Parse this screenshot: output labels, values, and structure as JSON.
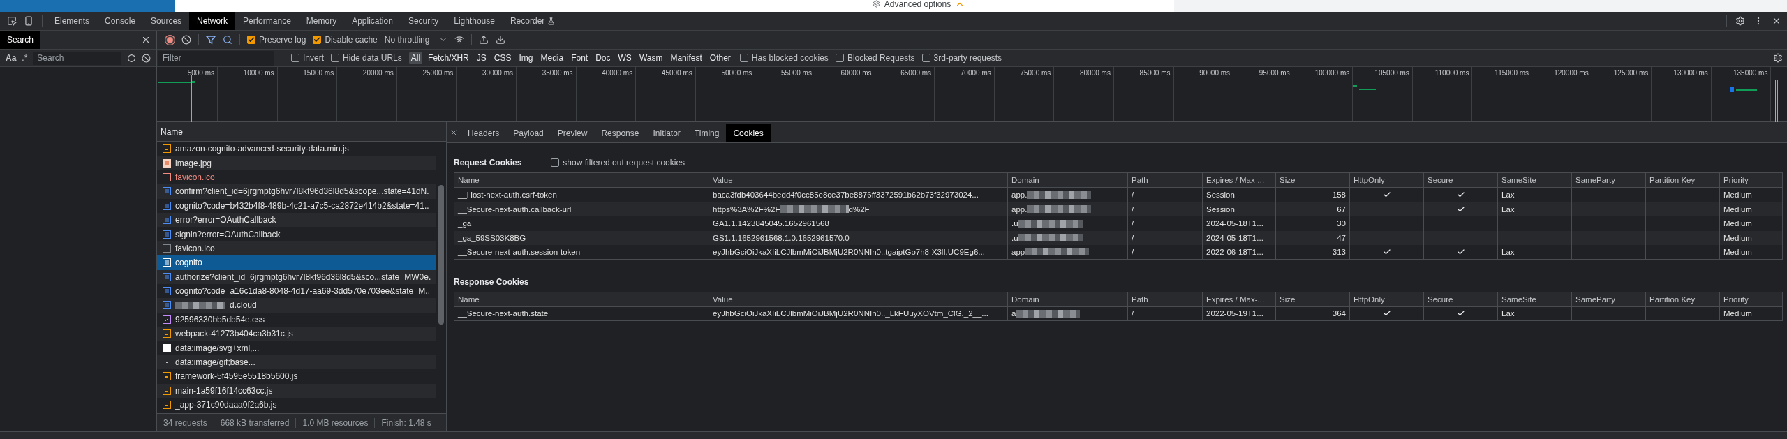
{
  "page_strip": {
    "text": "Advanced options"
  },
  "devtools_tabs": [
    {
      "label": "Elements",
      "selected": false
    },
    {
      "label": "Console",
      "selected": false
    },
    {
      "label": "Sources",
      "selected": false
    },
    {
      "label": "Network",
      "selected": true
    },
    {
      "label": "Performance",
      "selected": false
    },
    {
      "label": "Memory",
      "selected": false
    },
    {
      "label": "Application",
      "selected": false
    },
    {
      "label": "Security",
      "selected": false
    },
    {
      "label": "Lighthouse",
      "selected": false
    },
    {
      "label": "Recorder",
      "selected": false,
      "kind": "experimental"
    }
  ],
  "search_panel": {
    "tab": "Search",
    "case_toggle": "Aa",
    "regex_toggle": ".*",
    "placeholder": "Search"
  },
  "toolbar": {
    "checkboxes": [
      {
        "label": "Preserve log",
        "checked": true
      },
      {
        "label": "Disable cache",
        "checked": true
      }
    ],
    "throttling": "No throttling"
  },
  "filter": {
    "placeholder": "Filter",
    "checkboxes_left": [
      {
        "label": "Invert",
        "checked": false
      },
      {
        "label": "Hide data URLs",
        "checked": false
      }
    ],
    "types": [
      {
        "label": "All",
        "selected": true
      },
      {
        "label": "Fetch/XHR",
        "selected": false
      },
      {
        "label": "JS",
        "selected": false
      },
      {
        "label": "CSS",
        "selected": false
      },
      {
        "label": "Img",
        "selected": false
      },
      {
        "label": "Media",
        "selected": false
      },
      {
        "label": "Font",
        "selected": false
      },
      {
        "label": "Doc",
        "selected": false
      },
      {
        "label": "WS",
        "selected": false
      },
      {
        "label": "Wasm",
        "selected": false
      },
      {
        "label": "Manifest",
        "selected": false
      },
      {
        "label": "Other",
        "selected": false
      }
    ],
    "checkboxes_right": [
      {
        "label": "Has blocked cookies",
        "checked": false
      },
      {
        "label": "Blocked Requests",
        "checked": false
      },
      {
        "label": "3rd-party requests",
        "checked": false
      }
    ]
  },
  "timeline": {
    "ticks": [
      "5000 ms",
      "10000 ms",
      "15000 ms",
      "20000 ms",
      "25000 ms",
      "30000 ms",
      "35000 ms",
      "40000 ms",
      "45000 ms",
      "50000 ms",
      "55000 ms",
      "60000 ms",
      "65000 ms",
      "70000 ms",
      "75000 ms",
      "80000 ms",
      "85000 ms",
      "90000 ms",
      "95000 ms",
      "100000 ms",
      "105000 ms",
      "110000 ms",
      "115000 ms",
      "120000 ms",
      "125000 ms",
      "130000 ms",
      "135000 ms"
    ]
  },
  "requests": {
    "header": "Name",
    "rows": [
      {
        "name": "amazon-cognito-advanced-security-data.min.js",
        "kind": "script",
        "selected": false
      },
      {
        "name": "image.jpg",
        "kind": "image",
        "selected": false
      },
      {
        "name": "favicon.ico",
        "kind": "failed",
        "selected": false
      },
      {
        "name": "confirm?client_id=6jrgmptg6hvr7l8kf96d36l8d5&scope...state=41dN.",
        "kind": "document",
        "selected": false
      },
      {
        "name": "cognito?code=b432b4f8-489b-4c21-a7c5-ca2872e414b2&state=41..",
        "kind": "document",
        "selected": false
      },
      {
        "name": "error?error=OAuthCallback",
        "kind": "document",
        "selected": false
      },
      {
        "name": "signin?error=OAuthCallback",
        "kind": "document",
        "selected": false
      },
      {
        "name": "favicon.ico",
        "kind": "other",
        "selected": false
      },
      {
        "name": "cognito",
        "kind": "document",
        "selected": true
      },
      {
        "name": "authorize?client_id=6jrgmptg6hvr7l8kf96d36l8d5&sco...state=MW0e.",
        "kind": "document",
        "selected": false
      },
      {
        "name": "cognito?code=a16c1da8-8048-4d17-aa69-3dd570e703ee&state=M..",
        "kind": "document",
        "selected": false
      },
      {
        "name": "d.cloud",
        "kind": "document",
        "selected": false,
        "redacted_prefix": true
      },
      {
        "name": "92596330bb5db54e.css",
        "kind": "stylesheet",
        "selected": false
      },
      {
        "name": "webpack-41273b404ca3b31c.js",
        "kind": "script",
        "selected": false
      },
      {
        "name": "data:image/svg+xml,...",
        "kind": "svg",
        "selected": false
      },
      {
        "name": "data:image/gif;base...",
        "kind": "gif",
        "selected": false
      },
      {
        "name": "framework-5f4595e5518b5600.js",
        "kind": "script",
        "selected": false
      },
      {
        "name": "main-1a59f16f14cc63cc.js",
        "kind": "script",
        "selected": false
      },
      {
        "name": "_app-371c90daaa0f2a6b.js",
        "kind": "script",
        "selected": false
      }
    ],
    "status": [
      "34 requests",
      "668 kB transferred",
      "1.0 MB resources",
      "Finish: 1.48 s"
    ]
  },
  "details": {
    "tabs": [
      {
        "label": "Headers",
        "selected": false
      },
      {
        "label": "Payload",
        "selected": false
      },
      {
        "label": "Preview",
        "selected": false
      },
      {
        "label": "Response",
        "selected": false
      },
      {
        "label": "Initiator",
        "selected": false
      },
      {
        "label": "Timing",
        "selected": false
      },
      {
        "label": "Cookies",
        "selected": true
      }
    ],
    "request_cookies": {
      "title": "Request Cookies",
      "filter_toggle": {
        "label": "show filtered out request cookies",
        "checked": false
      },
      "columns": [
        "Name",
        "Value",
        "Domain",
        "Path",
        "Expires / Max-...",
        "Size",
        "HttpOnly",
        "Secure",
        "SameSite",
        "SameParty",
        "Partition Key",
        "Priority"
      ],
      "rows": [
        {
          "name": "__Host-next-auth.csrf-token",
          "value": [
            "baca3fdb403644bedd4f0cc85e8ce37be8876ff3372591b62b73f32973024..."
          ],
          "domain": "app.",
          "domain_redacted": true,
          "path": "/",
          "expires": "Session",
          "size": "158",
          "http_only": true,
          "secure": true,
          "same_site": "Lax",
          "priority": "Medium"
        },
        {
          "name": "__Secure-next-auth.callback-url",
          "value": [
            "https%3A%2F%2F",
            "d%2F"
          ],
          "domain": "app.",
          "domain_redacted": true,
          "path": "/",
          "expires": "Session",
          "size": "67",
          "http_only": false,
          "secure": true,
          "same_site": "Lax",
          "priority": "Medium"
        },
        {
          "name": "_ga",
          "value": [
            "GA1.1.1423845045.1652961568"
          ],
          "domain": ".u",
          "domain_redacted": true,
          "path": "/",
          "expires": "2024-05-18T1...",
          "size": "30",
          "http_only": false,
          "secure": false,
          "priority": "Medium"
        },
        {
          "name": "_ga_59SS03K8BG",
          "value": [
            "GS1.1.1652961568.1.0.1652961570.0"
          ],
          "domain": ".u",
          "domain_redacted": true,
          "path": "/",
          "expires": "2024-05-18T1...",
          "size": "47",
          "http_only": false,
          "secure": false,
          "priority": "Medium"
        },
        {
          "name": "__Secure-next-auth.session-token",
          "value": [
            "eyJhbGciOiJkaXIiLCJlbmMiOiJBMjU2R0NNIn0..tgaiptGo7h8-X3lI.UC9Eg6..."
          ],
          "domain": "app",
          "domain_redacted": true,
          "path": "/",
          "expires": "2022-06-18T1...",
          "size": "313",
          "http_only": true,
          "secure": true,
          "same_site": "Lax",
          "priority": "Medium"
        }
      ]
    },
    "response_cookies": {
      "title": "Response Cookies",
      "columns": [
        "Name",
        "Value",
        "Domain",
        "Path",
        "Expires / Max-...",
        "Size",
        "HttpOnly",
        "Secure",
        "SameSite",
        "SameParty",
        "Partition Key",
        "Priority"
      ],
      "rows": [
        {
          "name": "__Secure-next-auth.state",
          "value": [
            "eyJhbGciOiJkaXIiLCJlbmMiOiJBMjU2R0NNIn0.._LkFUuyXOVtm_ClG._2__..."
          ],
          "domain": "a",
          "domain_redacted": true,
          "path": "/",
          "expires": "2022-05-19T1...",
          "size": "364",
          "http_only": true,
          "secure": true,
          "same_site": "Lax",
          "priority": "Medium"
        }
      ]
    }
  }
}
